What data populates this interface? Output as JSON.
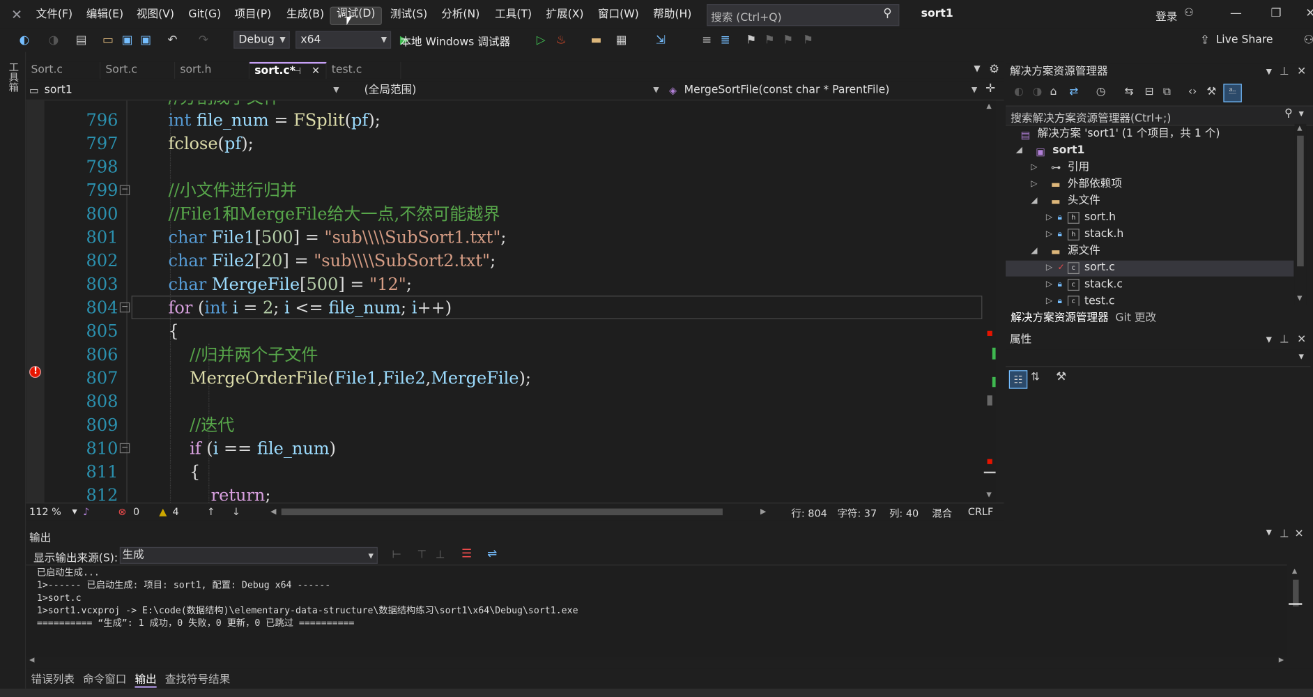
{
  "app": {
    "title": "sort1"
  },
  "menu": [
    "文件(F)",
    "编辑(E)",
    "视图(V)",
    "Git(G)",
    "项目(P)",
    "生成(B)",
    "调试(D)",
    "测试(S)",
    "分析(N)",
    "工具(T)",
    "扩展(X)",
    "窗口(W)",
    "帮助(H)"
  ],
  "search": {
    "placeholder": "搜索 (Ctrl+Q)"
  },
  "account": {
    "login": "登录"
  },
  "toolbar": {
    "config": "Debug",
    "platform": "x64",
    "run_label": "本地 Windows 调试器",
    "live_share": "Live Share"
  },
  "toolstrip": {
    "label": "工具箱"
  },
  "tabs": [
    {
      "label": "Sort.c"
    },
    {
      "label": "Sort.c"
    },
    {
      "label": "sort.h"
    },
    {
      "label": "sort.c*"
    },
    {
      "label": "test.c"
    }
  ],
  "navbar": {
    "project": "sort1",
    "scope": "(全局范围)",
    "member": "MergeSortFile(const char * ParentFile)"
  },
  "editor": {
    "lines": [
      {
        "n": "796"
      },
      {
        "n": "797"
      },
      {
        "n": "798"
      },
      {
        "n": "799"
      },
      {
        "n": "800"
      },
      {
        "n": "801"
      },
      {
        "n": "802"
      },
      {
        "n": "803"
      },
      {
        "n": "804"
      },
      {
        "n": "805"
      },
      {
        "n": "806"
      },
      {
        "n": "807"
      },
      {
        "n": "808"
      },
      {
        "n": "809"
      },
      {
        "n": "810"
      },
      {
        "n": "811"
      },
      {
        "n": "812"
      }
    ]
  },
  "editor_status": {
    "zoom": "112 %",
    "errors": "0",
    "warnings": "4",
    "line": "行: 804",
    "char": "字符: 37",
    "col": "列: 40",
    "mode": "混合",
    "eol": "CRLF"
  },
  "solution": {
    "title": "解决方案资源管理器",
    "search_placeholder": "搜索解决方案资源管理器(Ctrl+;)",
    "root": "解决方案 'sort1' (1 个项目，共 1 个)",
    "project": "sort1",
    "refs": "引用",
    "external": "外部依赖项",
    "headers": "头文件",
    "sort_h": "sort.h",
    "stack_h": "stack.h",
    "sources": "源文件",
    "sort_c": "sort.c",
    "stack_c": "stack.c",
    "test_c": "test.c",
    "tab_solution": "解决方案资源管理器",
    "tab_git": "Git 更改"
  },
  "properties": {
    "title": "属性"
  },
  "output": {
    "title": "输出",
    "source_label": "显示输出来源(S):",
    "source_value": "生成",
    "lines": [
      "已启动生成...",
      "1>------ 已启动生成: 项目: sort1, 配置: Debug x64 ------",
      "1>sort.c",
      "1>sort1.vcxproj -> E:\\code(数据结构)\\elementary-data-structure\\数据结构练习\\sort1\\x64\\Debug\\sort1.exe",
      "========== “生成”: 1 成功，0 失败，0 更新，0 已跳过 =========="
    ]
  },
  "bottom_tabs": [
    "错误列表",
    "命令窗口",
    "输出",
    "查找符号结果"
  ],
  "colors": {
    "accent": "#c6a0f6",
    "breakpoint": "#e51400",
    "keyword": "#569cd6",
    "comment": "#57a64a",
    "string": "#d69d85"
  }
}
